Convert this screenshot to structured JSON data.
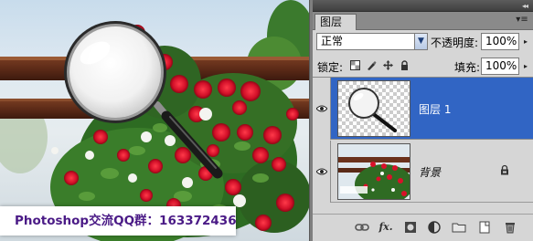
{
  "watermark": {
    "text": "Photoshop交流QQ群：163372436"
  },
  "panel": {
    "tab_label": "图层",
    "menu_icon": "panel-menu-icon",
    "blend_mode": "正常",
    "opacity_label": "不透明度:",
    "opacity_value": "100%",
    "lock_label": "锁定:",
    "fill_label": "填充:",
    "fill_value": "100%",
    "layers": [
      {
        "name": "图层 1",
        "selected": true,
        "visible": true
      },
      {
        "name": "背景",
        "selected": false,
        "visible": true,
        "locked": true
      }
    ],
    "bottom_icons": [
      "link-layers-icon",
      "fx-icon",
      "add-mask-icon",
      "adjustment-layer-icon",
      "new-group-icon",
      "new-layer-icon",
      "trash-icon"
    ],
    "fx_label": "fx."
  },
  "colors": {
    "selection_blue": "#3165c4",
    "panel_gray": "#d6d6d6",
    "watermark_text": "#4a1a86"
  }
}
